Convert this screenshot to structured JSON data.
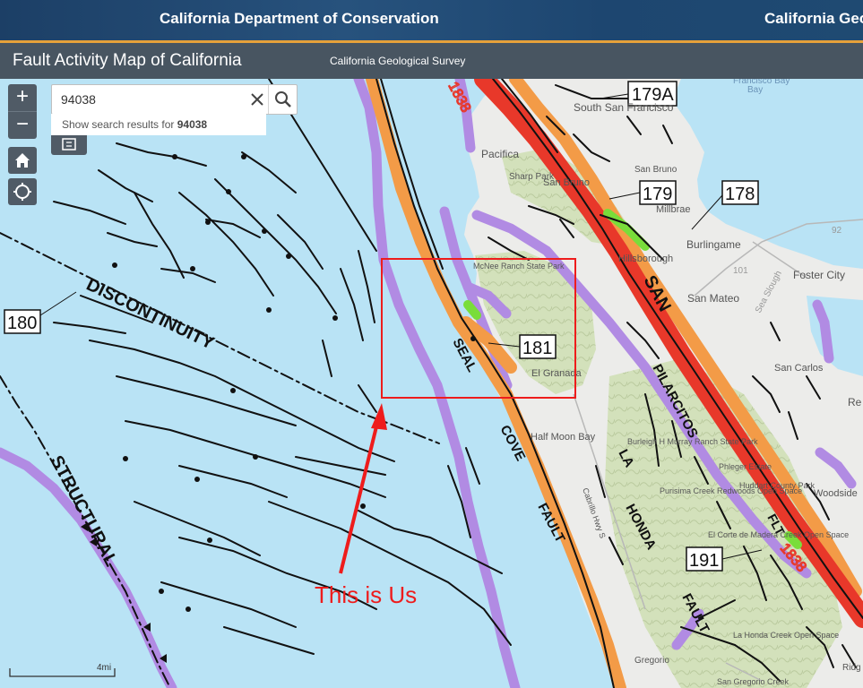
{
  "header": {
    "department": "California Department of Conservation",
    "department_clipped": "California Geo"
  },
  "app": {
    "title": "Fault Activity Map of California",
    "subtitle": "California Geological Survey"
  },
  "search": {
    "value": "94038",
    "suggestion_prefix": "Show search results for",
    "suggestion_term": "94038"
  },
  "controls": {
    "zoom_in": "+",
    "zoom_out": "−"
  },
  "scale": {
    "label": "4mi"
  },
  "annotation": {
    "text": "This is Us",
    "color": "#ee1c1c"
  },
  "colors": {
    "water": "#b9e3f5",
    "land": "#ececea",
    "hills": "#cfe0b4",
    "fault_historic": "#e8382a",
    "fault_holocene": "#f39b47",
    "fault_quaternary": "#b18be3",
    "fault_recent_green": "#79dd3a"
  },
  "labels": {
    "fault_names": [
      "SAN",
      "PILARCITOS",
      "SEAL",
      "COVE",
      "FAULT",
      "LA",
      "HONDA",
      "FAULT",
      "FLT",
      "DISCONTINUITY",
      "STRUCTURAL"
    ],
    "places": [
      "Pacifica",
      "South San Francisco",
      "Sharp Park",
      "San Bruno",
      "San Bruno",
      "Millbrae",
      "Burlingame",
      "Hillsborough",
      "Foster City",
      "San Mateo",
      "San Carlos",
      "McNee Ranch State Park",
      "El Granada",
      "Half Moon Bay",
      "Burleigh H Murray Ranch State Park",
      "Phleger Estate",
      "Huddart County Park",
      "Purisima Creek Redwoods Open Space",
      "El Corte de Madera Creek Open Space",
      "La Honda Creek Open Space",
      "Woodside",
      "Re",
      "Cabrillo Hwy S",
      "Francisco Bay",
      "Bay",
      "Gregorio",
      "San Gregorio Creek",
      "Ridg"
    ],
    "map_numbers": [
      "179A",
      "179",
      "178",
      "180",
      "181",
      "191",
      "1838",
      "1838",
      "92",
      "101",
      "Sea Slough"
    ]
  }
}
